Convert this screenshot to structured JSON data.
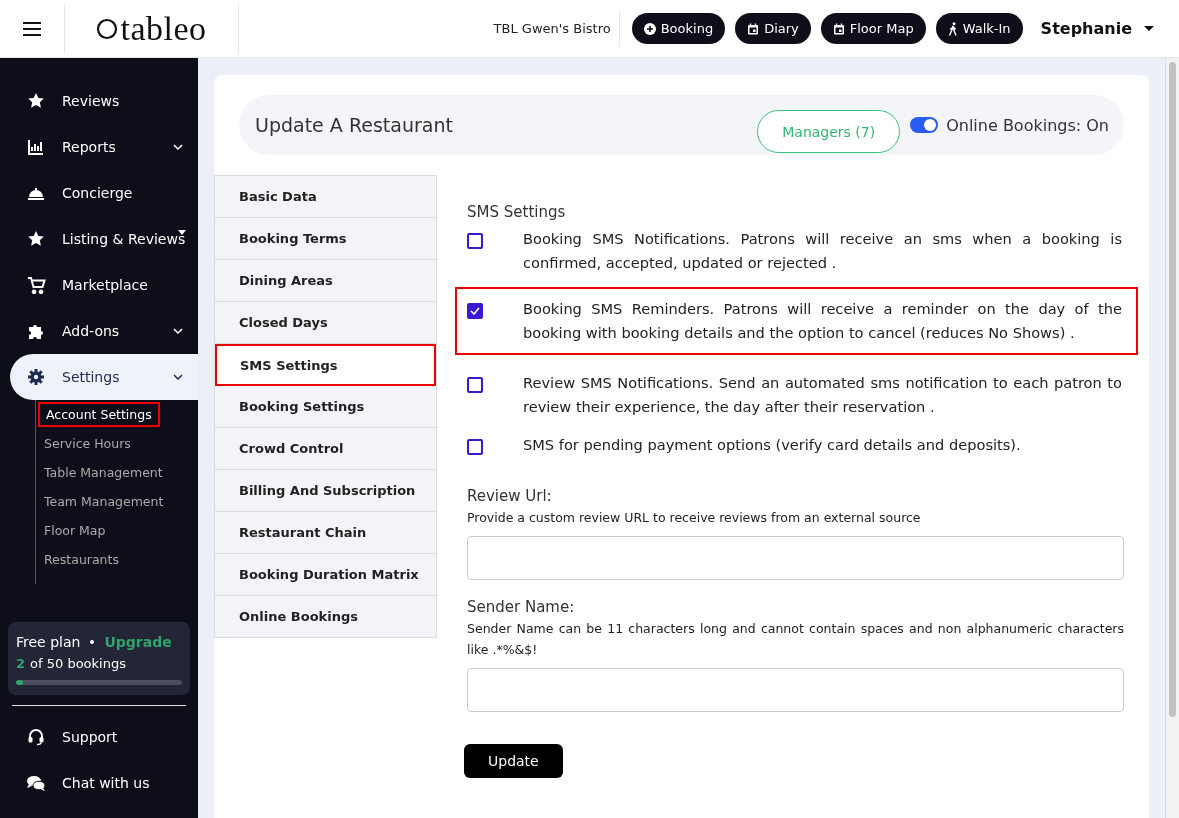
{
  "header": {
    "logo": "tableo",
    "restaurant": "TBL Gwen's Bistro",
    "actions": [
      {
        "label": "Booking"
      },
      {
        "label": "Diary"
      },
      {
        "label": "Floor Map"
      },
      {
        "label": "Walk-In"
      }
    ],
    "user": "Stephanie"
  },
  "sidebar": {
    "items": [
      {
        "label": "Reviews",
        "selected": false
      },
      {
        "label": "Reports",
        "selected": false
      },
      {
        "label": "Concierge",
        "selected": false
      },
      {
        "label": "Listing & Reviews",
        "selected": false
      },
      {
        "label": "Marketplace",
        "selected": false
      },
      {
        "label": "Add-ons",
        "selected": false
      },
      {
        "label": "Settings",
        "selected": true,
        "children": [
          {
            "label": "Account Settings",
            "selected": true
          },
          {
            "label": "Service Hours",
            "selected": false
          },
          {
            "label": "Table Management",
            "selected": false
          },
          {
            "label": "Team Management",
            "selected": false
          },
          {
            "label": "Floor Map",
            "selected": false
          },
          {
            "label": "Restaurants",
            "selected": false
          }
        ]
      }
    ],
    "plan": {
      "name": "Free plan",
      "upgrade": "Upgrade",
      "used": "2",
      "usage": "of 50 bookings",
      "level": 0.04
    },
    "footer": [
      {
        "label": "Support"
      },
      {
        "label": "Chat with us"
      }
    ]
  },
  "card": {
    "title": "Update A Restaurant",
    "managers_button": "Managers (7)",
    "toggle": {
      "label": "Online Bookings: On",
      "on": true
    },
    "tabs": [
      {
        "label": "Basic Data",
        "selected": false
      },
      {
        "label": "Booking Terms",
        "selected": false
      },
      {
        "label": "Dining Areas",
        "selected": false
      },
      {
        "label": "Closed Days",
        "selected": false
      },
      {
        "label": "SMS Settings",
        "selected": true
      },
      {
        "label": "Booking Settings",
        "selected": false
      },
      {
        "label": "Crowd Control",
        "selected": false
      },
      {
        "label": "Billing And Subscription",
        "selected": false
      },
      {
        "label": "Restaurant Chain",
        "selected": false
      },
      {
        "label": "Booking Duration Matrix",
        "selected": false
      },
      {
        "label": "Online Bookings",
        "selected": false
      }
    ],
    "section_title": "SMS Settings",
    "options": [
      {
        "label": "Booking SMS Notifications. Patrons will receive an sms when a booking is confirmed, accepted, updated or rejected .",
        "checked": false,
        "highlighted": false
      },
      {
        "label": "Booking SMS Reminders. Patrons will receive a reminder on the day of the booking with booking details and the option to cancel (reduces No Shows) .",
        "checked": true,
        "highlighted": true
      },
      {
        "label": "Review SMS Notifications. Send an automated sms notification to each patron to review their experience, the day after their reservation .",
        "checked": false,
        "highlighted": false
      },
      {
        "label": "SMS for pending payment options (verify card details and deposits).",
        "checked": false,
        "highlighted": false
      }
    ],
    "fields": [
      {
        "label": "Review Url:",
        "help": "Provide a custom review URL to receive reviews from an external source"
      },
      {
        "label": "Sender Name:",
        "help": "Sender Name can be 11 characters long and cannot contain spaces and non alphanumeric characters like .*%&$!"
      }
    ],
    "submit": "Update"
  }
}
